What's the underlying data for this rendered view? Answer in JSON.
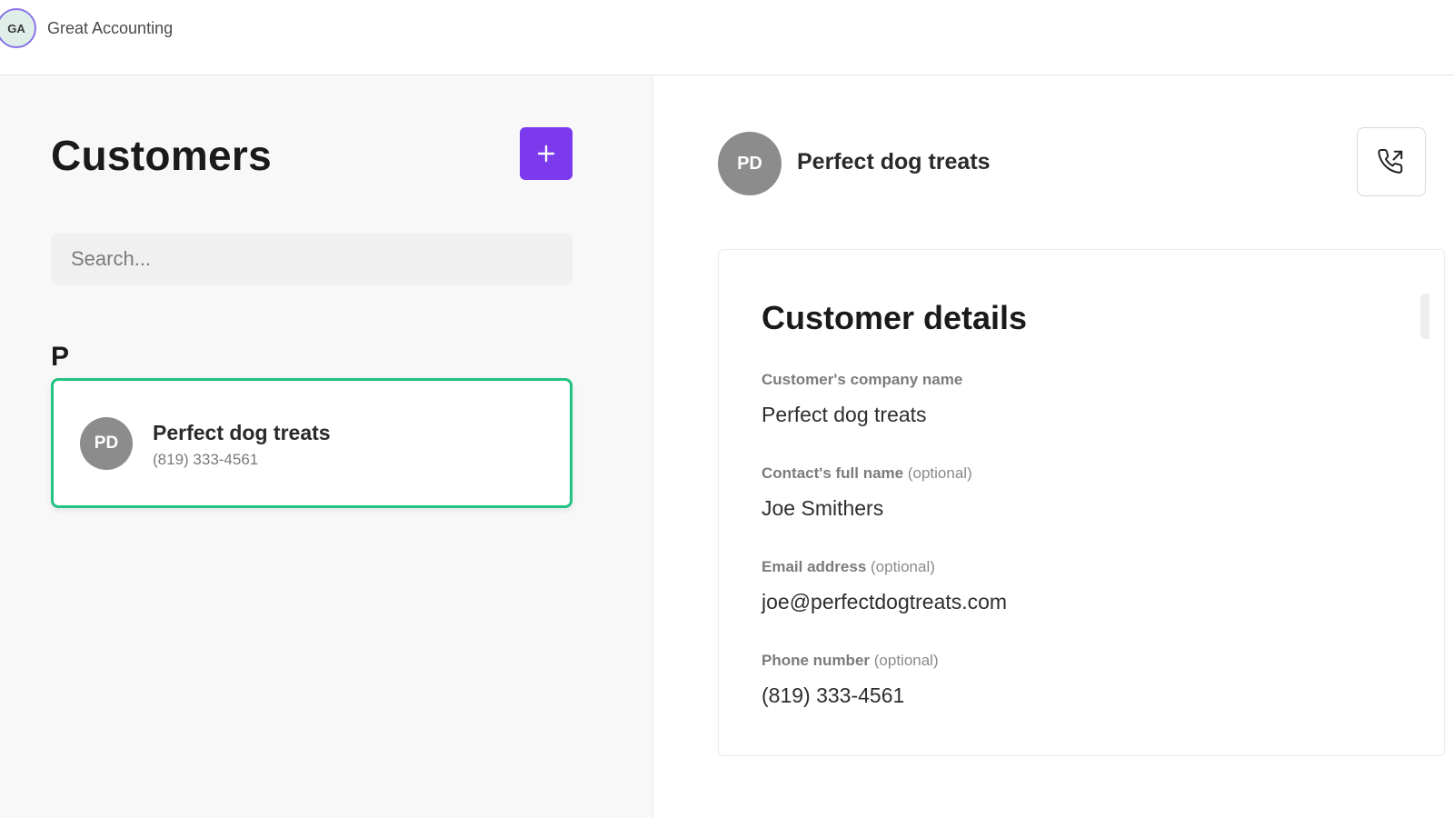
{
  "header": {
    "org_initials": "GA",
    "org_name": "Great Accounting"
  },
  "customers_panel": {
    "title": "Customers",
    "add_button_label": "+",
    "search_placeholder": "Search...",
    "groups": [
      {
        "letter": "P",
        "customers": [
          {
            "initials": "PD",
            "name": "Perfect dog treats",
            "phone": "(819) 333-4561",
            "selected": true
          }
        ]
      }
    ]
  },
  "detail_panel": {
    "initials": "PD",
    "name": "Perfect dog treats",
    "call_icon": "phone-outgoing-icon",
    "card": {
      "title": "Customer details",
      "fields": [
        {
          "label": "Customer's company name",
          "optional": "",
          "value": "Perfect dog treats"
        },
        {
          "label": "Contact's full name",
          "optional": "(optional)",
          "value": "Joe Smithers"
        },
        {
          "label": "Email address",
          "optional": "(optional)",
          "value": "joe@perfectdogtreats.com"
        },
        {
          "label": "Phone number",
          "optional": "(optional)",
          "value": "(819) 333-4561"
        }
      ]
    }
  },
  "colors": {
    "accent": "#7c3aed",
    "selected_border": "#22c382",
    "avatar_gray": "#8c8c8c"
  }
}
